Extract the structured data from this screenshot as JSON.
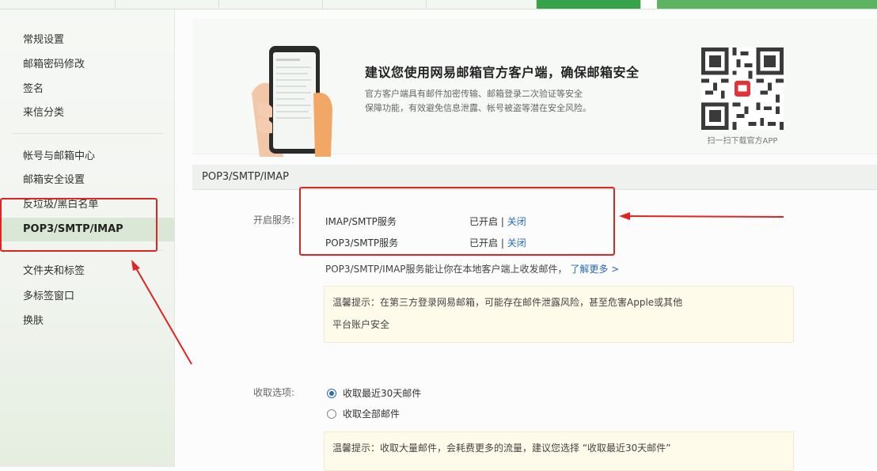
{
  "colors": {
    "accent_green": "#36a34a",
    "highlight_red": "#e02424",
    "link_blue": "#2a6ab8",
    "tip_bg": "#fffbea"
  },
  "sidebar": {
    "group1": [
      {
        "label": "常规设置"
      },
      {
        "label": "邮箱密码修改"
      },
      {
        "label": "签名"
      },
      {
        "label": "来信分类"
      }
    ],
    "group2": [
      {
        "label": "帐号与邮箱中心"
      },
      {
        "label": "邮箱安全设置"
      },
      {
        "label": "反垃圾/黑白名单"
      },
      {
        "label": "POP3/SMTP/IMAP",
        "active": true
      }
    ],
    "group3": [
      {
        "label": "文件夹和标签"
      },
      {
        "label": "多标签窗口"
      },
      {
        "label": "换肤"
      }
    ]
  },
  "banner": {
    "title": "建议您使用网易邮箱官方客户端，确保邮箱安全",
    "desc_line1": "官方客户端具有邮件加密传输、邮箱登录二次验证等安全",
    "desc_line2": "保障功能，有效避免信息泄露、帐号被盗等潜在安全风险。",
    "qr_caption": "扫一扫下载官方APP",
    "icons": {
      "phone": "phone-hand-illustration",
      "qr": "qr-code-icon"
    }
  },
  "section": {
    "title": "POP3/SMTP/IMAP",
    "services_label": "开启服务:",
    "services": [
      {
        "name": "IMAP/SMTP服务",
        "status": "已开启",
        "separator": "|",
        "action": "关闭"
      },
      {
        "name": "POP3/SMTP服务",
        "status": "已开启",
        "separator": "|",
        "action": "关闭"
      }
    ],
    "info_text": "POP3/SMTP/IMAP服务能让你在本地客户端上收发邮件，",
    "info_link": "了解更多 >",
    "tip1_line1": "温馨提示：在第三方登录网易邮箱，可能存在邮件泄露风险，甚至危害Apple或其他",
    "tip1_line2": "平台账户安全",
    "receive_label": "收取选项:",
    "receive_options": [
      {
        "label": "收取最近30天邮件",
        "checked": true
      },
      {
        "label": "收取全部邮件",
        "checked": false
      }
    ],
    "tip2": "温馨提示：收取大量邮件，会耗费更多的流量，建议您选择 “收取最近30天邮件”"
  }
}
